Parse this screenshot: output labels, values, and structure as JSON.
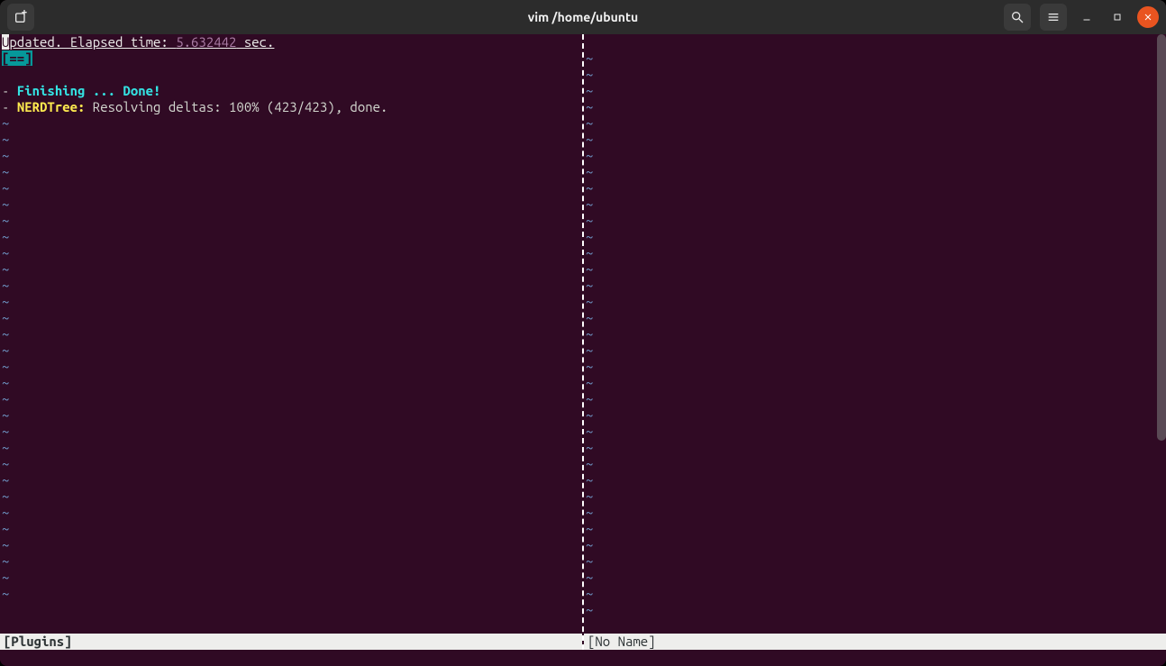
{
  "titlebar": {
    "title": "vim /home/ubuntu"
  },
  "left": {
    "header_prefix": "U",
    "header_rest": "pdated. Elapsed time: ",
    "header_num": "5.632442",
    "header_suffix": " sec.",
    "progress": "[==]",
    "lines": [
      {
        "dash": "- ",
        "label": "Finishing ... Done!",
        "label_class": "teal"
      },
      {
        "dash": "- ",
        "label": "NERDTree:",
        "label_class": "yellow",
        "rest": " Resolving deltas: 100% (423/423), done."
      }
    ],
    "status": "[Plugins]"
  },
  "right": {
    "status": "[No Name]"
  },
  "tilde": "~",
  "left_tilde_count": 30,
  "right_tilde_count": 35
}
